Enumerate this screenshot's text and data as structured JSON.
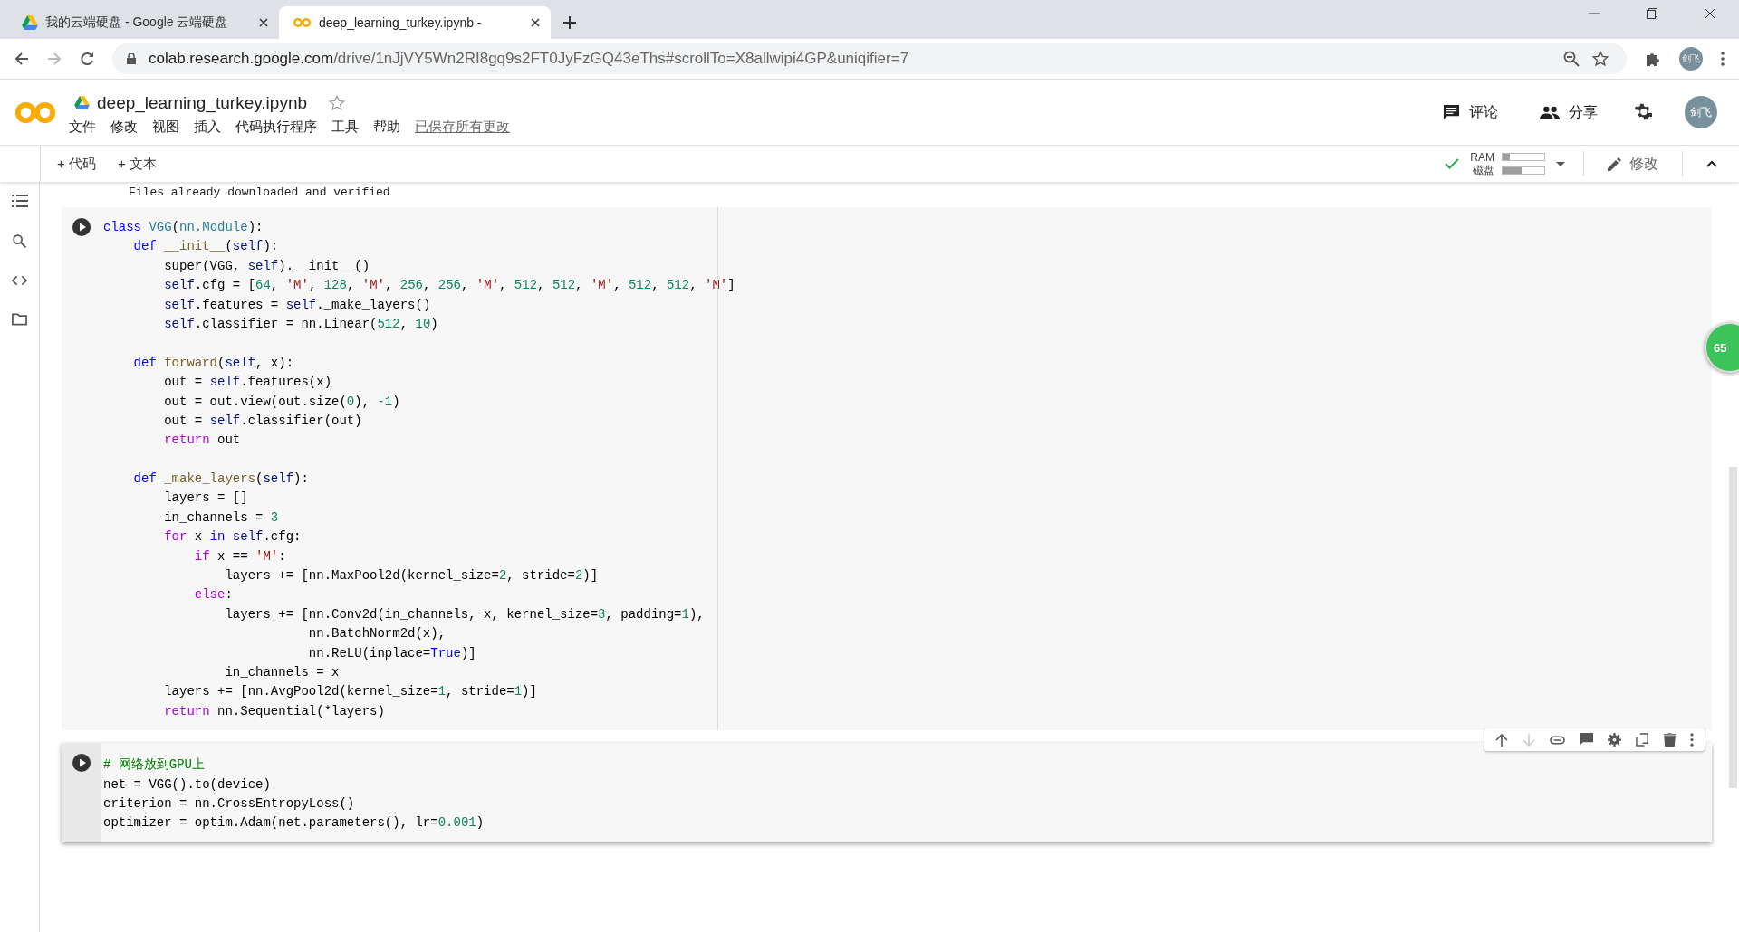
{
  "browser": {
    "tabs": [
      {
        "title": "我的云端硬盘 - Google 云端硬盘",
        "selected": false
      },
      {
        "title": "deep_learning_turkey.ipynb -",
        "selected": true
      }
    ],
    "url_host": "colab.research.google.com",
    "url_path": "/drive/1nJjVY5Wn2RI8gq9s2FT0JyFzGQ43eThs#scrollTo=X8allwipi4GP&uniqifier=7",
    "profile": "剑飞"
  },
  "notebook": {
    "title": "deep_learning_turkey.ipynb",
    "menu": [
      "文件",
      "修改",
      "视图",
      "插入",
      "代码执行程序",
      "工具",
      "帮助"
    ],
    "save_status": "已保存所有更改",
    "header_actions": [
      "评论",
      "分享"
    ],
    "user": "剑飞"
  },
  "toolbar": {
    "add": [
      "+ 代码",
      "+ 文本"
    ],
    "resources": [
      {
        "label": "RAM",
        "level": 0.18
      },
      {
        "label": "磁盘",
        "level": 0.45
      }
    ],
    "edit": "修改"
  },
  "output_text": "Files already downloaded and verified",
  "cells": [
    {
      "selected": false,
      "blocks": [
        [
          [
            {
              "kind": "keyword",
              "text": "class"
            },
            {
              "kind": "type",
              "text": " VGG"
            },
            {
              "kind": "plain",
              "text": "("
            },
            {
              "kind": "type",
              "text": "nn.Module"
            },
            {
              "kind": "plain",
              "text": "):"
            }
          ],
          [
            {
              "kind": "keyword",
              "text": "    def"
            },
            {
              "kind": "func",
              "text": " __init__"
            },
            {
              "kind": "plain",
              "text": "("
            },
            {
              "kind": "self",
              "text": "self"
            },
            {
              "kind": "plain",
              "text": "):"
            }
          ],
          [
            {
              "kind": "plain",
              "text": "        super(VGG, "
            },
            {
              "kind": "self",
              "text": "self"
            },
            {
              "kind": "plain",
              "text": ").__init__()"
            }
          ],
          [
            {
              "kind": "self",
              "text": "        self"
            },
            {
              "kind": "plain",
              "text": ".cfg = ["
            },
            {
              "kind": "number",
              "text": "64"
            },
            {
              "kind": "plain",
              "text": ", "
            },
            {
              "kind": "string",
              "text": "'M'"
            },
            {
              "kind": "plain",
              "text": ", "
            },
            {
              "kind": "number",
              "text": "128"
            },
            {
              "kind": "plain",
              "text": ", "
            },
            {
              "kind": "string",
              "text": "'M'"
            },
            {
              "kind": "plain",
              "text": ", "
            },
            {
              "kind": "number",
              "text": "256"
            },
            {
              "kind": "plain",
              "text": ", "
            },
            {
              "kind": "number",
              "text": "256"
            },
            {
              "kind": "plain",
              "text": ", "
            },
            {
              "kind": "string",
              "text": "'M'"
            },
            {
              "kind": "plain",
              "text": ", "
            },
            {
              "kind": "number",
              "text": "512"
            },
            {
              "kind": "plain",
              "text": ", "
            },
            {
              "kind": "number",
              "text": "512"
            },
            {
              "kind": "plain",
              "text": ", "
            },
            {
              "kind": "string",
              "text": "'M'"
            },
            {
              "kind": "plain",
              "text": ", "
            },
            {
              "kind": "number",
              "text": "512"
            },
            {
              "kind": "plain",
              "text": ", "
            },
            {
              "kind": "number",
              "text": "512"
            },
            {
              "kind": "plain",
              "text": ", "
            },
            {
              "kind": "string",
              "text": "'M'"
            },
            {
              "kind": "plain",
              "text": "]"
            }
          ],
          [
            {
              "kind": "self",
              "text": "        self"
            },
            {
              "kind": "plain",
              "text": ".features = "
            },
            {
              "kind": "self",
              "text": "self"
            },
            {
              "kind": "plain",
              "text": "._make_layers()"
            }
          ],
          [
            {
              "kind": "self",
              "text": "        self"
            },
            {
              "kind": "plain",
              "text": ".classifier = nn.Linear("
            },
            {
              "kind": "number",
              "text": "512"
            },
            {
              "kind": "plain",
              "text": ", "
            },
            {
              "kind": "number",
              "text": "10"
            },
            {
              "kind": "plain",
              "text": ")"
            }
          ]
        ],
        [
          [
            {
              "kind": "keyword",
              "text": "    def"
            },
            {
              "kind": "func",
              "text": " forward"
            },
            {
              "kind": "plain",
              "text": "("
            },
            {
              "kind": "self",
              "text": "self"
            },
            {
              "kind": "plain",
              "text": ", x):"
            }
          ],
          [
            {
              "kind": "plain",
              "text": "        out = "
            },
            {
              "kind": "self",
              "text": "self"
            },
            {
              "kind": "plain",
              "text": ".features(x)"
            }
          ],
          [
            {
              "kind": "plain",
              "text": "        out = out.view(out.size("
            },
            {
              "kind": "number",
              "text": "0"
            },
            {
              "kind": "plain",
              "text": "), "
            },
            {
              "kind": "number",
              "text": "-1"
            },
            {
              "kind": "plain",
              "text": ")"
            }
          ],
          [
            {
              "kind": "plain",
              "text": "        out = "
            },
            {
              "kind": "self",
              "text": "self"
            },
            {
              "kind": "plain",
              "text": ".classifier(out)"
            }
          ],
          [
            {
              "kind": "control",
              "text": "        return"
            },
            {
              "kind": "plain",
              "text": " out"
            }
          ]
        ],
        [
          [
            {
              "kind": "keyword",
              "text": "    def"
            },
            {
              "kind": "func",
              "text": " _make_layers"
            },
            {
              "kind": "plain",
              "text": "("
            },
            {
              "kind": "self",
              "text": "self"
            },
            {
              "kind": "plain",
              "text": "):"
            }
          ],
          [
            {
              "kind": "plain",
              "text": "        layers = []"
            }
          ],
          [
            {
              "kind": "plain",
              "text": "        in_channels = "
            },
            {
              "kind": "number",
              "text": "3"
            }
          ],
          [
            {
              "kind": "control",
              "text": "        for"
            },
            {
              "kind": "plain",
              "text": " x "
            },
            {
              "kind": "keyword",
              "text": "in"
            },
            {
              "kind": "self",
              "text": " self"
            },
            {
              "kind": "plain",
              "text": ".cfg:"
            }
          ],
          [
            {
              "kind": "control",
              "text": "            if"
            },
            {
              "kind": "plain",
              "text": " x == "
            },
            {
              "kind": "string",
              "text": "'M'"
            },
            {
              "kind": "plain",
              "text": ":"
            }
          ],
          [
            {
              "kind": "plain",
              "text": "                layers += [nn.MaxPool2d(kernel_size="
            },
            {
              "kind": "number",
              "text": "2"
            },
            {
              "kind": "plain",
              "text": ", stride="
            },
            {
              "kind": "number",
              "text": "2"
            },
            {
              "kind": "plain",
              "text": ")]"
            }
          ],
          [
            {
              "kind": "control",
              "text": "            else"
            },
            {
              "kind": "plain",
              "text": ":"
            }
          ],
          [
            {
              "kind": "plain",
              "text": "                layers += [nn.Conv2d(in_channels, x, kernel_size="
            },
            {
              "kind": "number",
              "text": "3"
            },
            {
              "kind": "plain",
              "text": ", padding="
            },
            {
              "kind": "number",
              "text": "1"
            },
            {
              "kind": "plain",
              "text": "),"
            }
          ],
          [
            {
              "kind": "plain",
              "text": "                           nn.BatchNorm2d(x),"
            }
          ],
          [
            {
              "kind": "plain",
              "text": "                           nn.ReLU(inplace="
            },
            {
              "kind": "keyword",
              "text": "True"
            },
            {
              "kind": "plain",
              "text": ")]"
            }
          ],
          [
            {
              "kind": "plain",
              "text": "                in_channels = x"
            }
          ],
          [
            {
              "kind": "plain",
              "text": "        layers += [nn.AvgPool2d(kernel_size="
            },
            {
              "kind": "number",
              "text": "1"
            },
            {
              "kind": "plain",
              "text": ", stride="
            },
            {
              "kind": "number",
              "text": "1"
            },
            {
              "kind": "plain",
              "text": ")]"
            }
          ],
          [
            {
              "kind": "control",
              "text": "        return"
            },
            {
              "kind": "plain",
              "text": " nn.Sequential(*layers)"
            }
          ]
        ]
      ]
    },
    {
      "selected": true,
      "blocks": [
        [
          [
            {
              "kind": "comment",
              "text": "# 网络放到GPU上"
            }
          ],
          [
            {
              "kind": "plain",
              "text": "net = VGG().to(device)"
            }
          ],
          [
            {
              "kind": "plain",
              "text": "criterion = nn.CrossEntropyLoss()"
            }
          ],
          [
            {
              "kind": "plain",
              "text": "optimizer = optim.Adam(net.parameters(), lr="
            },
            {
              "kind": "number",
              "text": "0.001"
            },
            {
              "kind": "plain",
              "text": ")"
            }
          ]
        ]
      ]
    }
  ],
  "floating_badge": "65"
}
